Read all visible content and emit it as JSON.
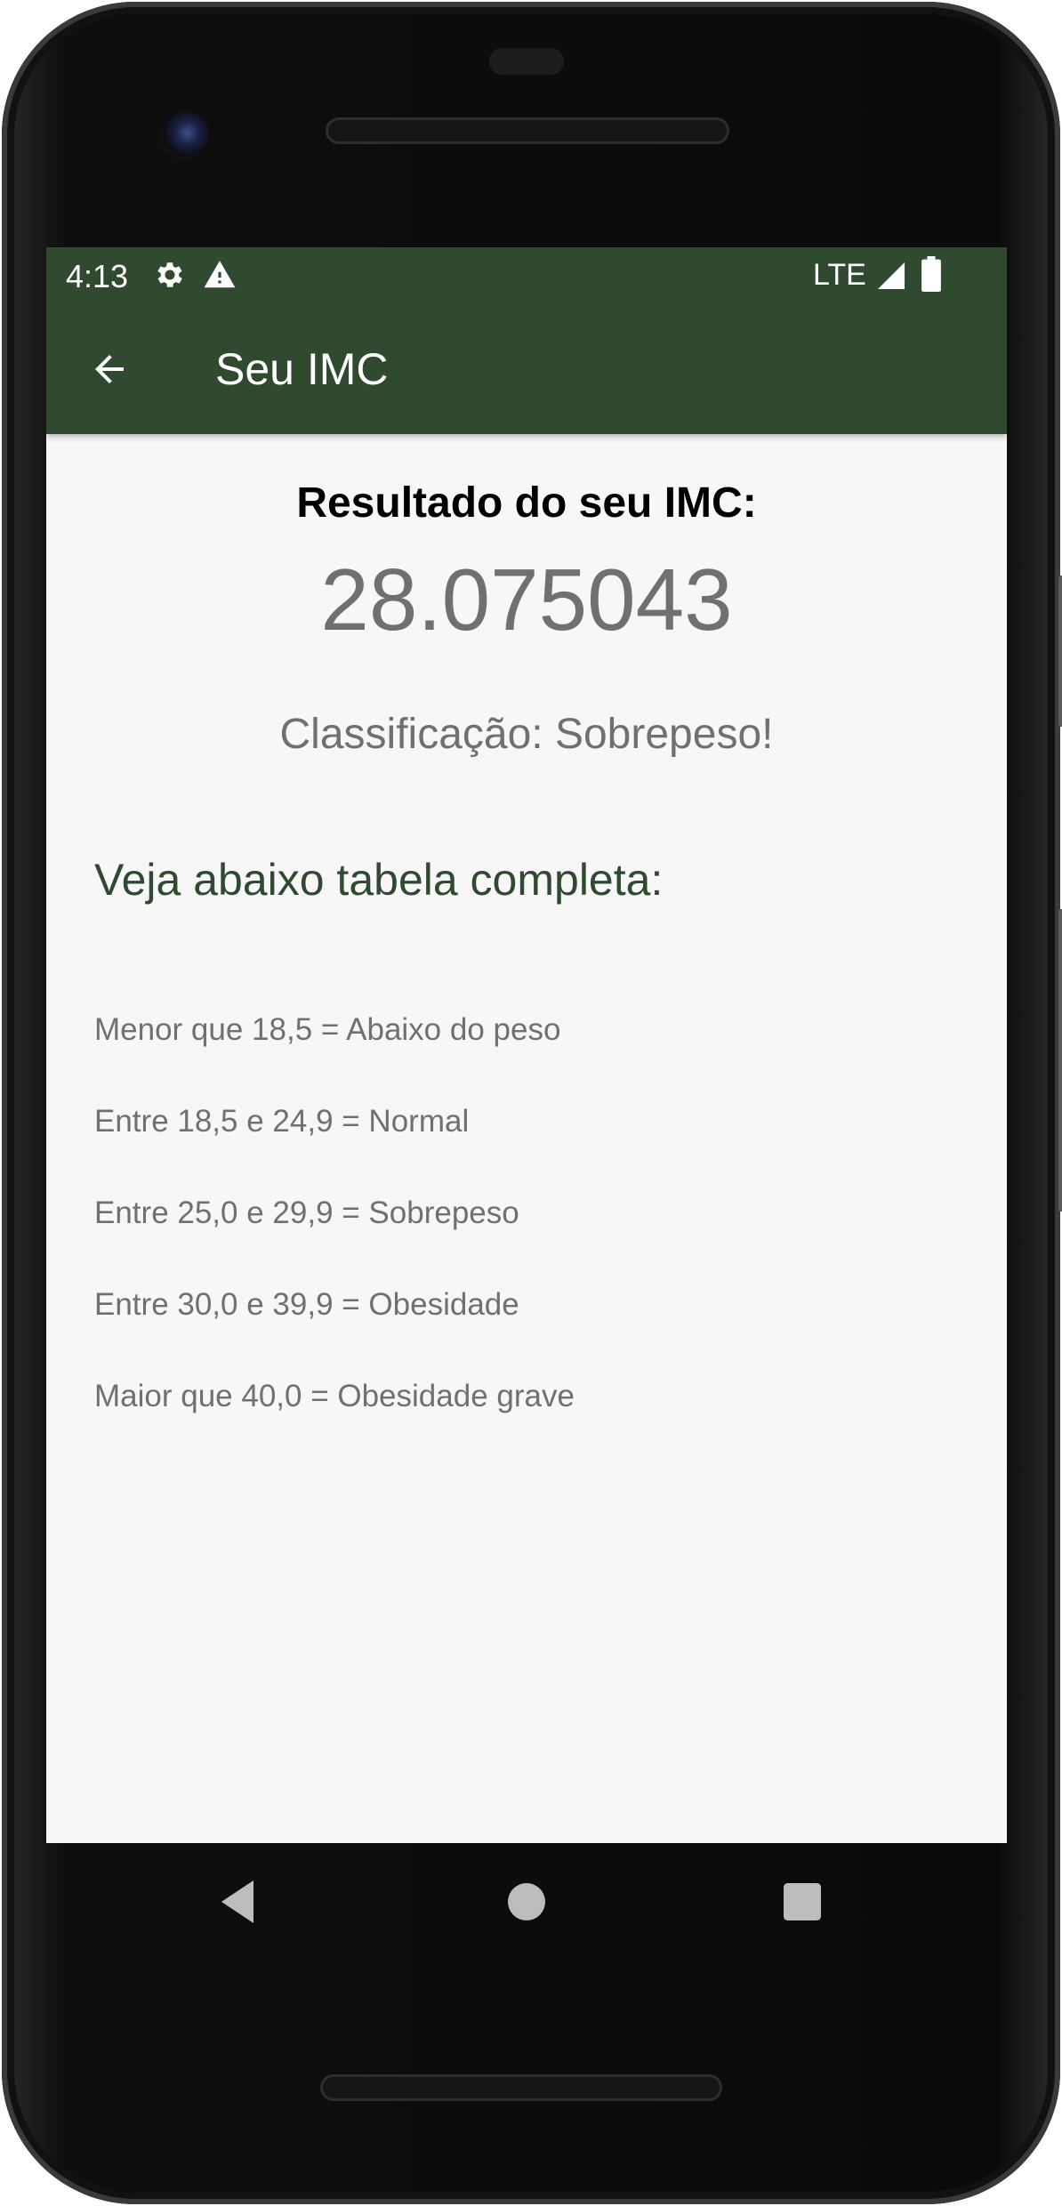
{
  "status_bar": {
    "time": "4:13",
    "network": "LTE",
    "icons": [
      "gear-icon",
      "warning-icon",
      "signal-icon",
      "battery-icon"
    ]
  },
  "app_bar": {
    "title": "Seu IMC",
    "back_icon": "arrow-left-icon"
  },
  "result": {
    "title": "Resultado do seu IMC:",
    "value": "28.075043",
    "classification": "Classificação: Sobrepeso!"
  },
  "table": {
    "title": "Veja abaixo tabela completa:",
    "rows": [
      "Menor que 18,5 = Abaixo do peso",
      "Entre 18,5 e 24,9 = Normal",
      "Entre 25,0 e 29,9 = Sobrepeso",
      "Entre 30,0 e 39,9 = Obesidade",
      "Maior que 40,0 = Obesidade grave"
    ]
  },
  "nav_bar": {
    "icons": [
      "nav-back-icon",
      "nav-home-icon",
      "nav-recents-icon"
    ]
  },
  "colors": {
    "primary_dark_green": "#2f4a2f",
    "screen_background": "#f7f7f7",
    "secondary_text": "#707070"
  }
}
